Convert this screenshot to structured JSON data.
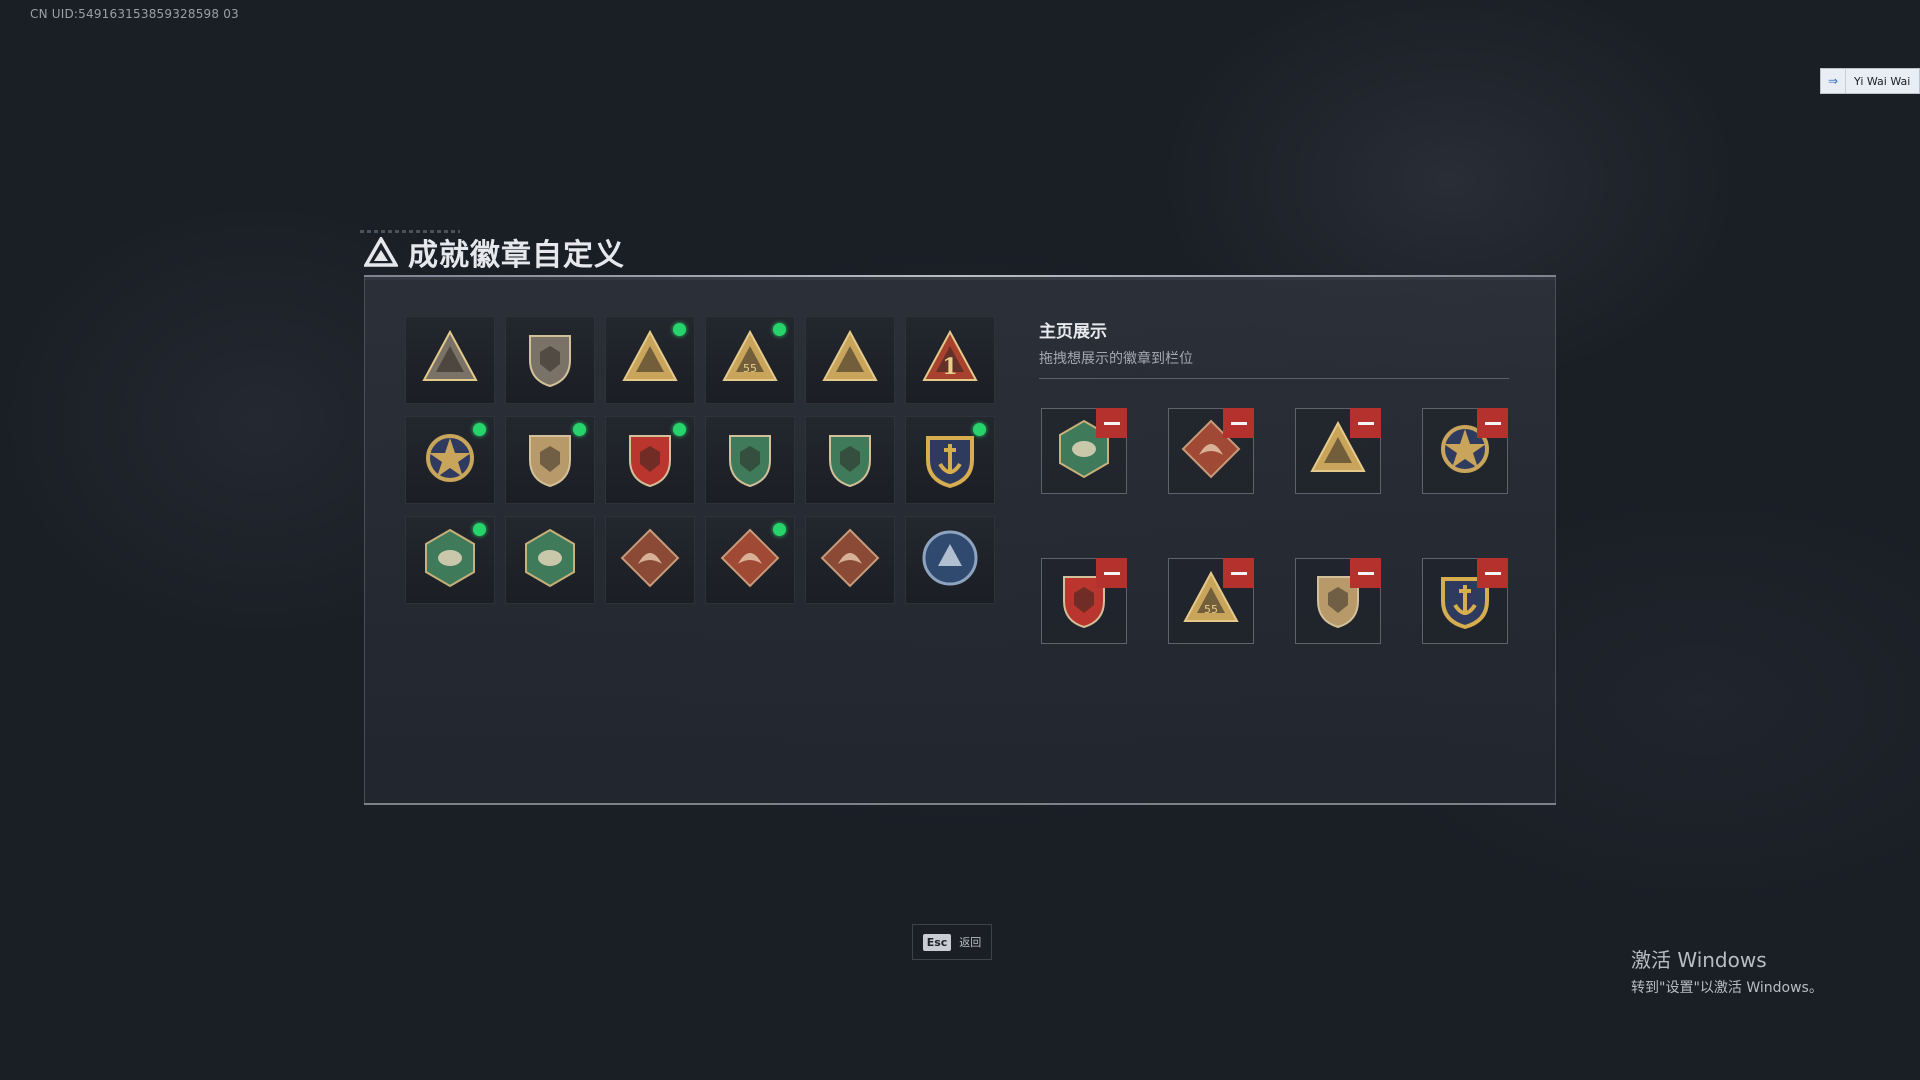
{
  "uid_text": "CN UID:549163153859328598 03",
  "user": {
    "name": "Yi Wai Wai",
    "icon": "login-arrow-icon"
  },
  "dialog": {
    "title": "成就徽章自定义",
    "icon": "triangle-logo-icon"
  },
  "badges": [
    {
      "name": "triangle-badge-icon",
      "new": false,
      "color": "#7a7266"
    },
    {
      "name": "helicopter-badge-icon",
      "new": false,
      "color": "#7a7266"
    },
    {
      "name": "sword-triangle-badge-icon",
      "new": true,
      "color": "#c9a45b"
    },
    {
      "name": "bag-55-triangle-badge-icon",
      "new": true,
      "color": "#c9a45b"
    },
    {
      "name": "hands-triangle-badge-icon",
      "new": false,
      "color": "#c9a45b"
    },
    {
      "name": "number-one-triangle-badge-icon",
      "new": false,
      "color": "#a8422f"
    },
    {
      "name": "star-medal-badge-icon",
      "new": true,
      "color": "#c9a45b"
    },
    {
      "name": "shield-chevron-badge-icon",
      "new": true,
      "color": "#b89a6a"
    },
    {
      "name": "eagle-shield-badge-icon",
      "new": true,
      "color": "#b9352d"
    },
    {
      "name": "green-rifle-shield-badge-icon",
      "new": false,
      "color": "#3f7a5a"
    },
    {
      "name": "green-crosshair-shield-badge-icon",
      "new": false,
      "color": "#3f7a5a"
    },
    {
      "name": "anchor-gold-badge-icon",
      "new": true,
      "color": "#d6ad4f"
    },
    {
      "name": "wasp-hexagon-badge-icon",
      "new": true,
      "color": "#3f7a5a"
    },
    {
      "name": "hand-hexagon-badge-icon",
      "new": false,
      "color": "#3f7a5a"
    },
    {
      "name": "dragon-diamond-badge-icon",
      "new": false,
      "color": "#8a4a36"
    },
    {
      "name": "dragon-diamond-red-badge-icon",
      "new": true,
      "color": "#a04a36"
    },
    {
      "name": "runner-diamond-badge-icon",
      "new": false,
      "color": "#8a4a36"
    },
    {
      "name": "wolf-circle-badge-icon",
      "new": false,
      "color": "#2f4a6e"
    }
  ],
  "showcase": {
    "title": "主页展示",
    "subtitle": "拖拽想展示的徽章到栏位",
    "slots": [
      {
        "name": "wasp-hexagon-badge-icon",
        "color": "#3f7a5a"
      },
      {
        "name": "dragon-diamond-red-badge-icon",
        "color": "#a04a36"
      },
      {
        "name": "sword-triangle-badge-icon",
        "color": "#c9a45b"
      },
      {
        "name": "star-medal-badge-icon",
        "color": "#c9a45b"
      },
      {
        "name": "eagle-shield-badge-icon",
        "color": "#b9352d"
      },
      {
        "name": "bag-55-triangle-badge-icon",
        "color": "#c9a45b"
      },
      {
        "name": "shield-chevron-badge-icon",
        "color": "#b89a6a"
      },
      {
        "name": "anchor-gold-badge-icon",
        "color": "#d6ad4f"
      }
    ]
  },
  "esc": {
    "key": "Esc",
    "label": "返回"
  },
  "windows": {
    "line1": "激活 Windows",
    "line2": "转到\"设置\"以激活 Windows。"
  }
}
